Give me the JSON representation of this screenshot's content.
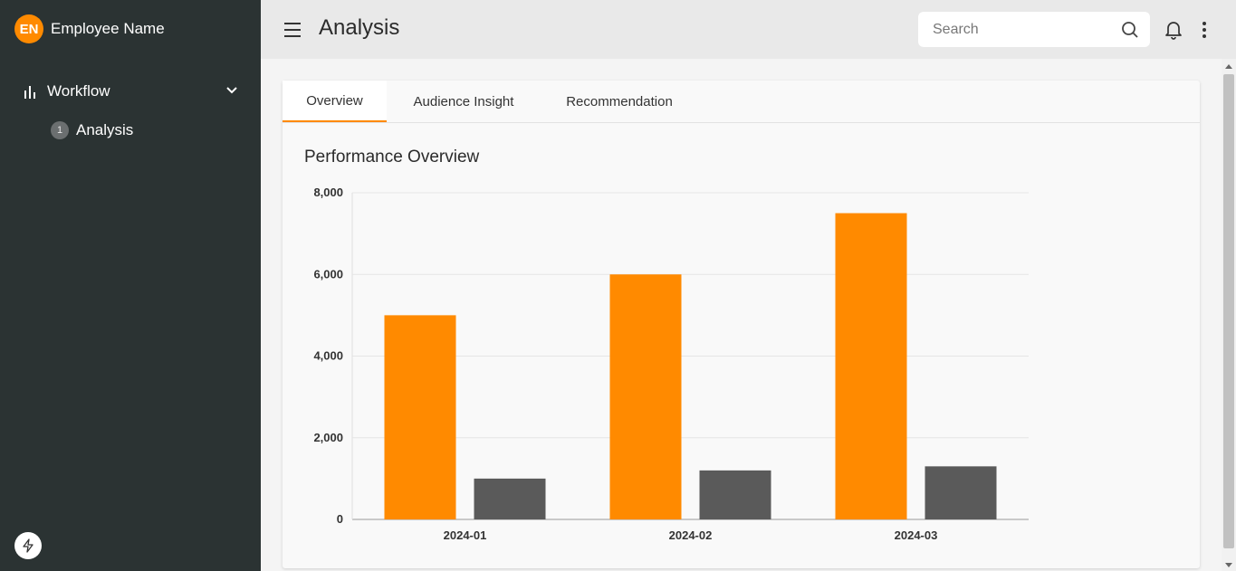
{
  "sidebar": {
    "avatar_initials": "EN",
    "user_name": "Employee Name",
    "nav": {
      "group_label": "Workflow",
      "sub_step": "1",
      "sub_label": "Analysis"
    }
  },
  "header": {
    "title": "Analysis",
    "search_placeholder": "Search"
  },
  "tabs": [
    "Overview",
    "Audience Insight",
    "Recommendation"
  ],
  "active_tab": "Overview",
  "card": {
    "title": "Performance Overview"
  },
  "colors": {
    "accent": "#ff8a00",
    "secondary_bar": "#5a5a5a",
    "sidebar_bg": "#2b3333"
  },
  "chart_data": {
    "type": "bar",
    "categories": [
      "2024-01",
      "2024-02",
      "2024-03"
    ],
    "series": [
      {
        "values": [
          5000,
          6000,
          7500
        ],
        "color": "#ff8a00"
      },
      {
        "values": [
          1000,
          1200,
          1300
        ],
        "color": "#5a5a5a"
      }
    ],
    "yticks": [
      "0",
      "2,000",
      "4,000",
      "6,000",
      "8,000"
    ],
    "ylim": [
      0,
      8000
    ],
    "grid": true
  }
}
